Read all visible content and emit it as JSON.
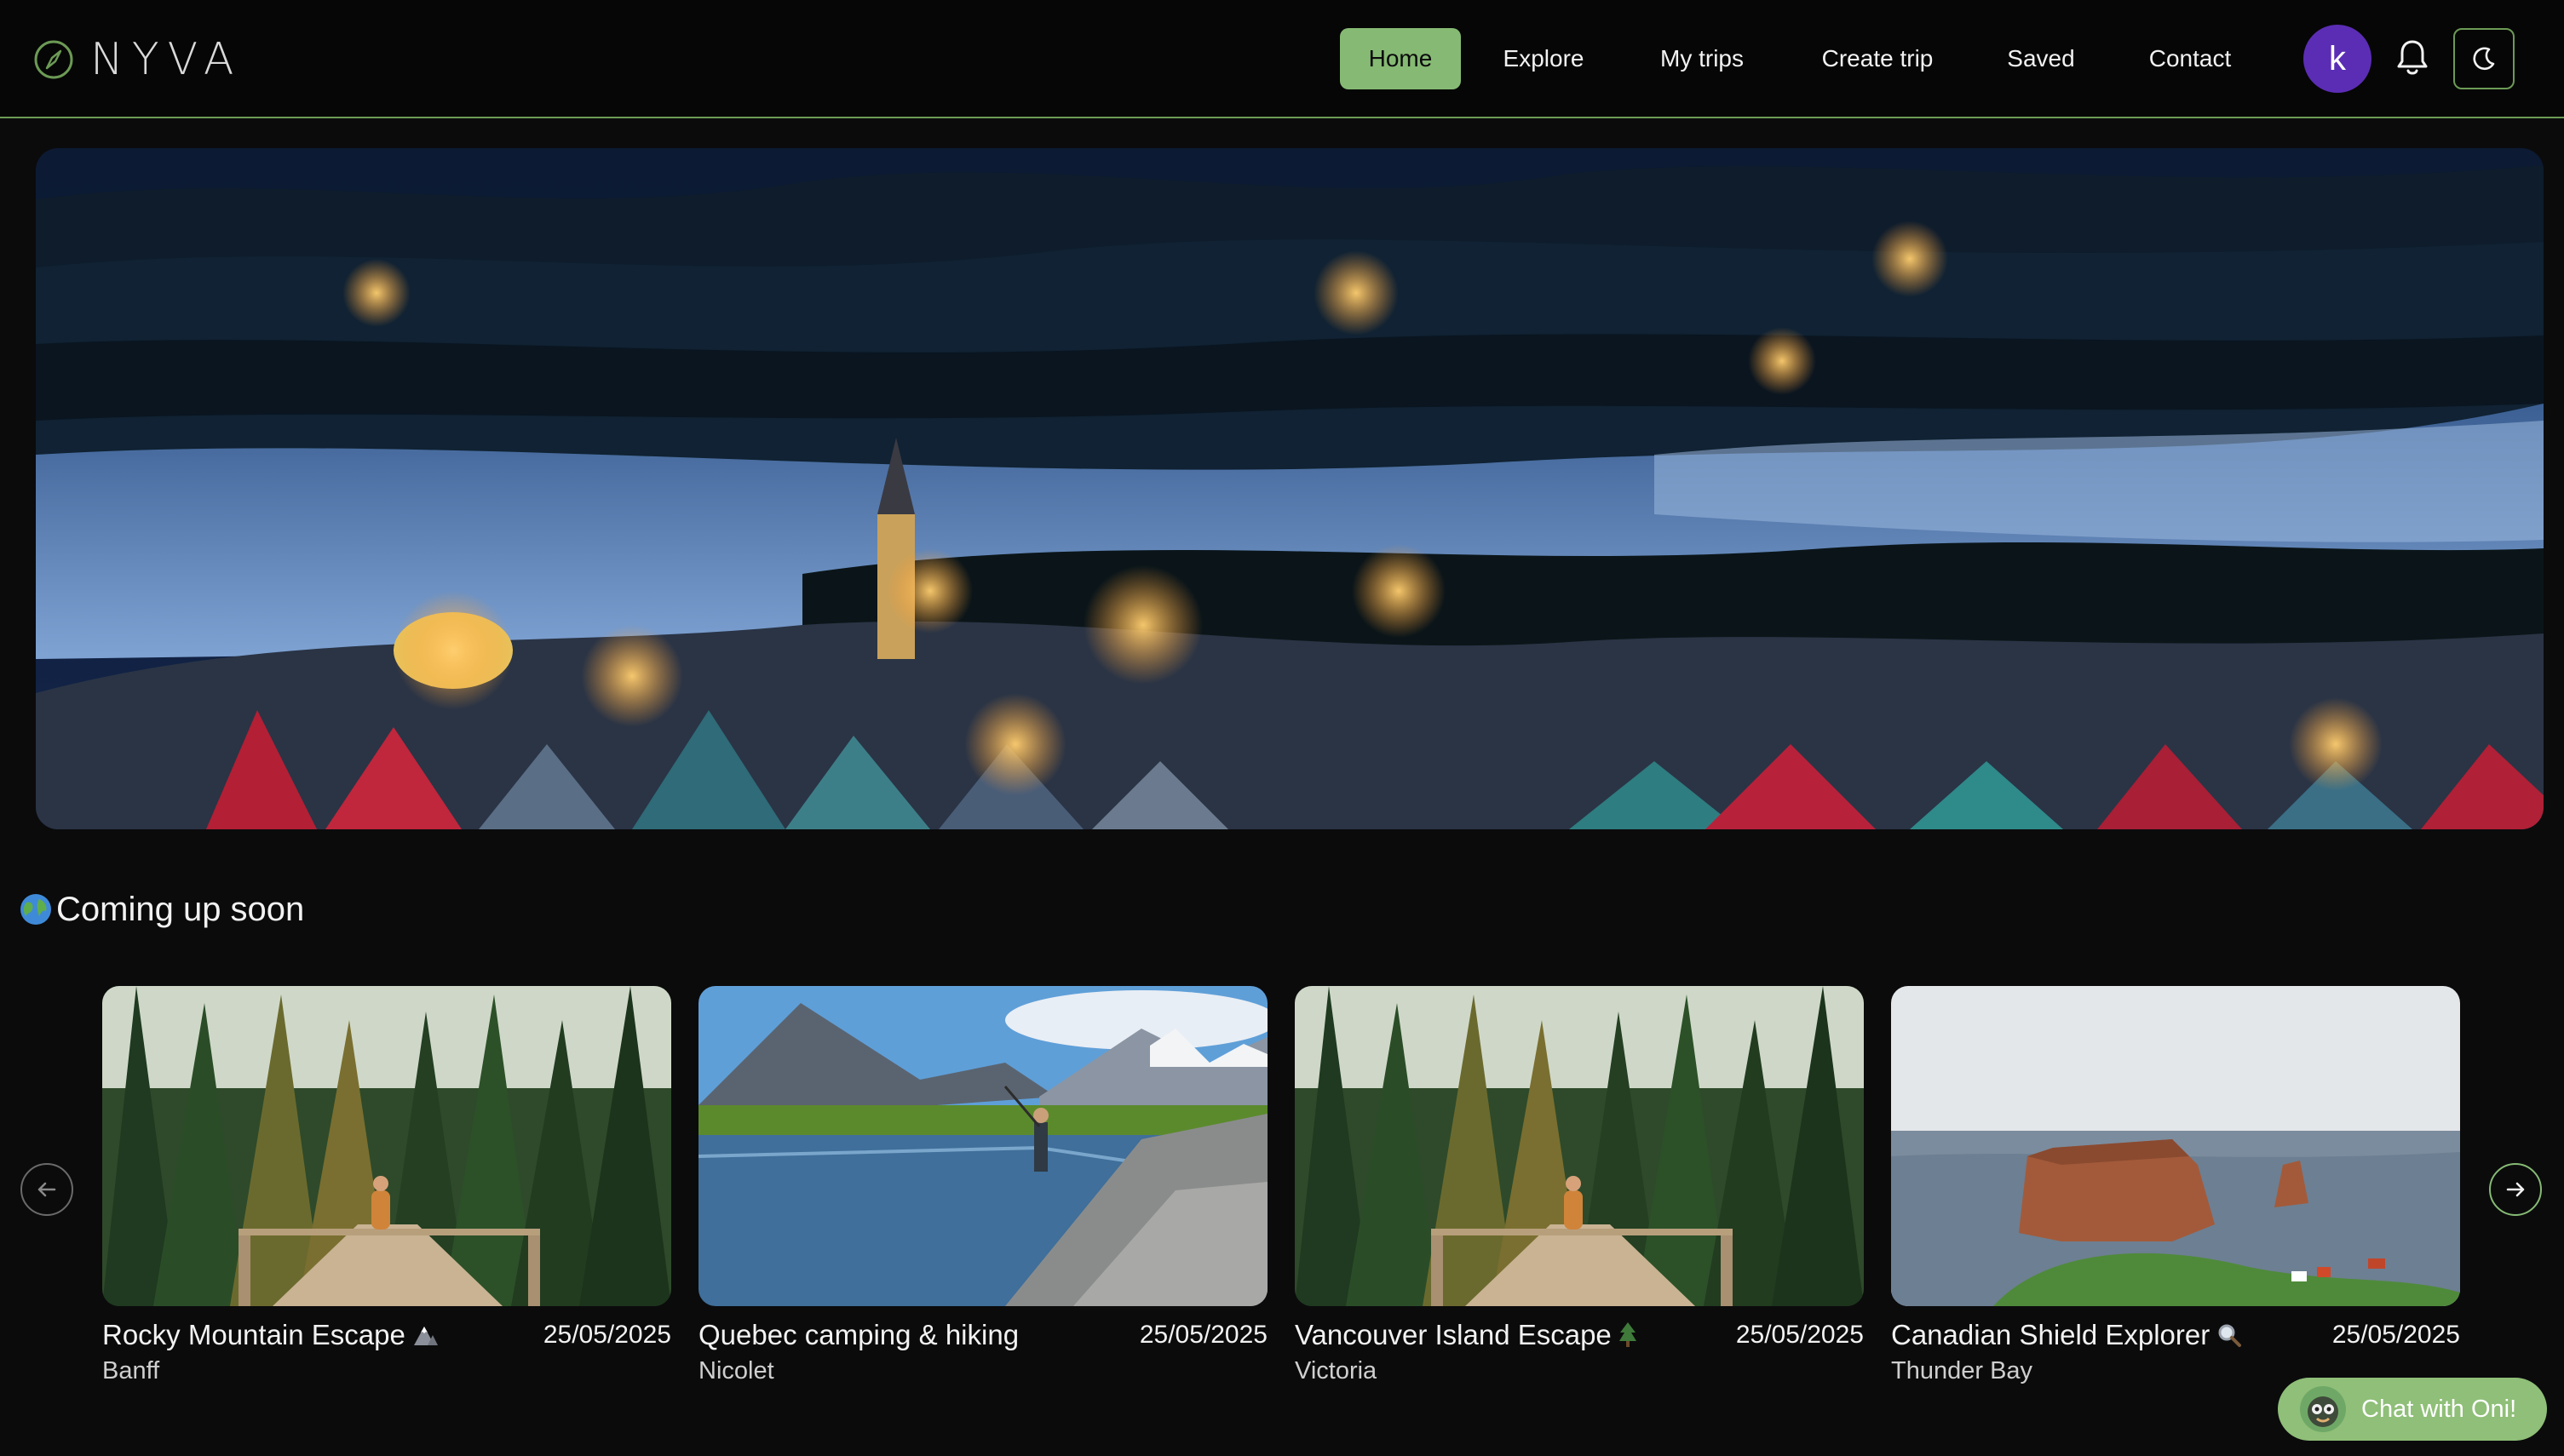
{
  "header": {
    "logo_text": "NYVA",
    "nav": [
      {
        "label": "Home",
        "active": true
      },
      {
        "label": "Explore",
        "active": false
      },
      {
        "label": "My trips",
        "active": false
      },
      {
        "label": "Create trip",
        "active": false
      },
      {
        "label": "Saved",
        "active": false
      },
      {
        "label": "Contact",
        "active": false
      }
    ],
    "avatar_initial": "k",
    "icons": {
      "logo": "compass-icon",
      "bell": "bell-icon",
      "theme": "moon-icon"
    }
  },
  "colors": {
    "accent": "#86ba74",
    "avatar": "#5b2db4",
    "background": "#0b0b0c",
    "chat_button": "#8fbf78"
  },
  "section": {
    "title": "Coming up soon",
    "icon": "globe-icon"
  },
  "carousel": {
    "prev_icon": "arrow-left-icon",
    "next_icon": "arrow-right-icon",
    "cards": [
      {
        "title": "Rocky Mountain Escape",
        "emoji": "mountain-icon",
        "date": "25/05/2025",
        "location": "Banff"
      },
      {
        "title": "Quebec camping & hiking",
        "emoji": "",
        "date": "25/05/2025",
        "location": "Nicolet"
      },
      {
        "title": "Vancouver Island Escape",
        "emoji": "evergreen-tree-icon",
        "date": "25/05/2025",
        "location": "Victoria"
      },
      {
        "title": "Canadian Shield Explorer",
        "emoji": "magnifier-icon",
        "date": "25/05/2025",
        "location": "Thunder Bay"
      }
    ]
  },
  "chat": {
    "label": "Chat with Oni!"
  }
}
